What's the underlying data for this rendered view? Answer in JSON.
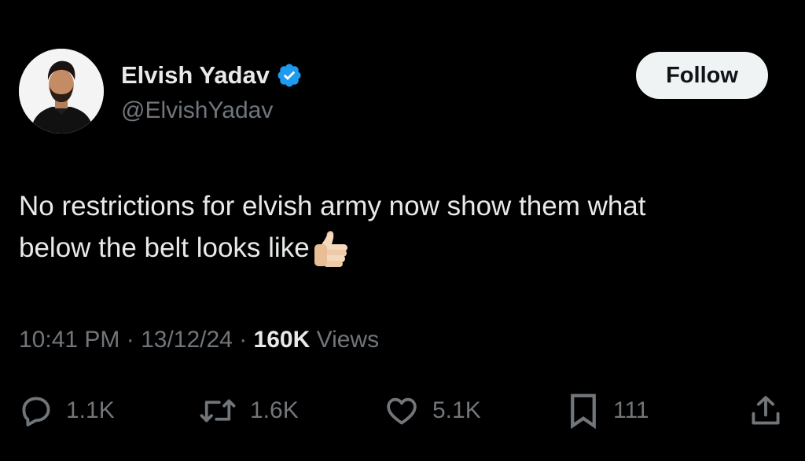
{
  "author": {
    "display_name": "Elvish Yadav",
    "handle": "@ElvishYadav",
    "verified": true,
    "verified_color": "#1d9bf0"
  },
  "follow_label": "Follow",
  "tweet": {
    "line1": "No restrictions for elvish army now show them what",
    "line2": "below the belt looks like",
    "emoji_icon": "thumbs-up-icon"
  },
  "meta": {
    "time": "10:41 PM",
    "date": "13/12/24",
    "views_count": "160K",
    "views_label": "Views"
  },
  "actions": {
    "replies": "1.1K",
    "reposts": "1.6K",
    "likes": "5.1K",
    "bookmarks": "111"
  },
  "colors": {
    "background": "#000000",
    "primary_text": "#e7e9ea",
    "secondary_text": "#71767b",
    "follow_button_bg": "#eff3f4",
    "follow_button_text": "#0f1419"
  }
}
